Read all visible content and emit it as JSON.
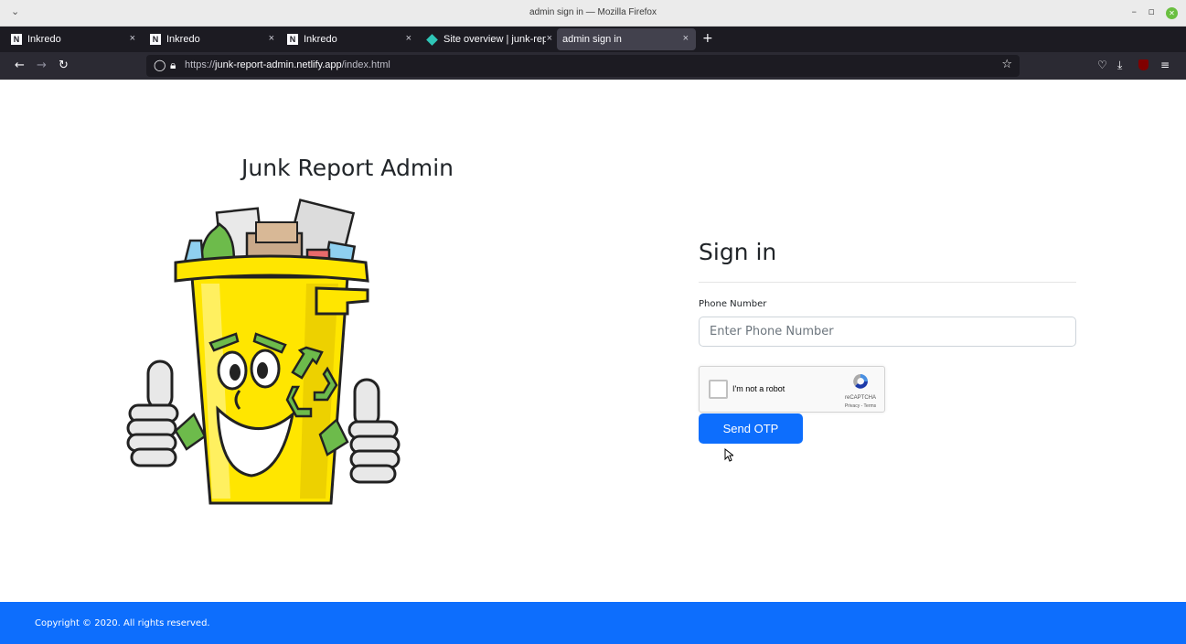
{
  "window": {
    "title": "admin sign in — Mozilla Firefox"
  },
  "tabs": [
    {
      "label": "Inkredo",
      "favicon": "inkredo-icon"
    },
    {
      "label": "Inkredo",
      "favicon": "inkredo-icon"
    },
    {
      "label": "Inkredo",
      "favicon": "inkredo-icon"
    },
    {
      "label": "Site overview | junk-rep",
      "favicon": "netlify-icon"
    },
    {
      "label": "admin sign in",
      "favicon": "none"
    }
  ],
  "nav": {
    "url_prefix": "https://",
    "url_host": "junk-report-admin.netlify.app",
    "url_path": "/index.html"
  },
  "brand": {
    "title": "Junk Report Admin"
  },
  "signin": {
    "title": "Sign in",
    "phone_label": "Phone Number",
    "phone_placeholder": "Enter Phone Number",
    "phone_value": "",
    "captcha_label": "I'm not a robot",
    "captcha_brand": "reCAPTCHA",
    "captcha_terms": "Privacy - Terms",
    "submit_label": "Send OTP"
  },
  "footer": {
    "copyright": "Copyright © 2020. All rights reserved."
  },
  "colors": {
    "primary": "#0d6efd",
    "tab_bg": "#1c1b22",
    "toolbar_bg": "#2b2a33",
    "mascot_yellow": "#ffe600",
    "mascot_green": "#7dc242"
  }
}
